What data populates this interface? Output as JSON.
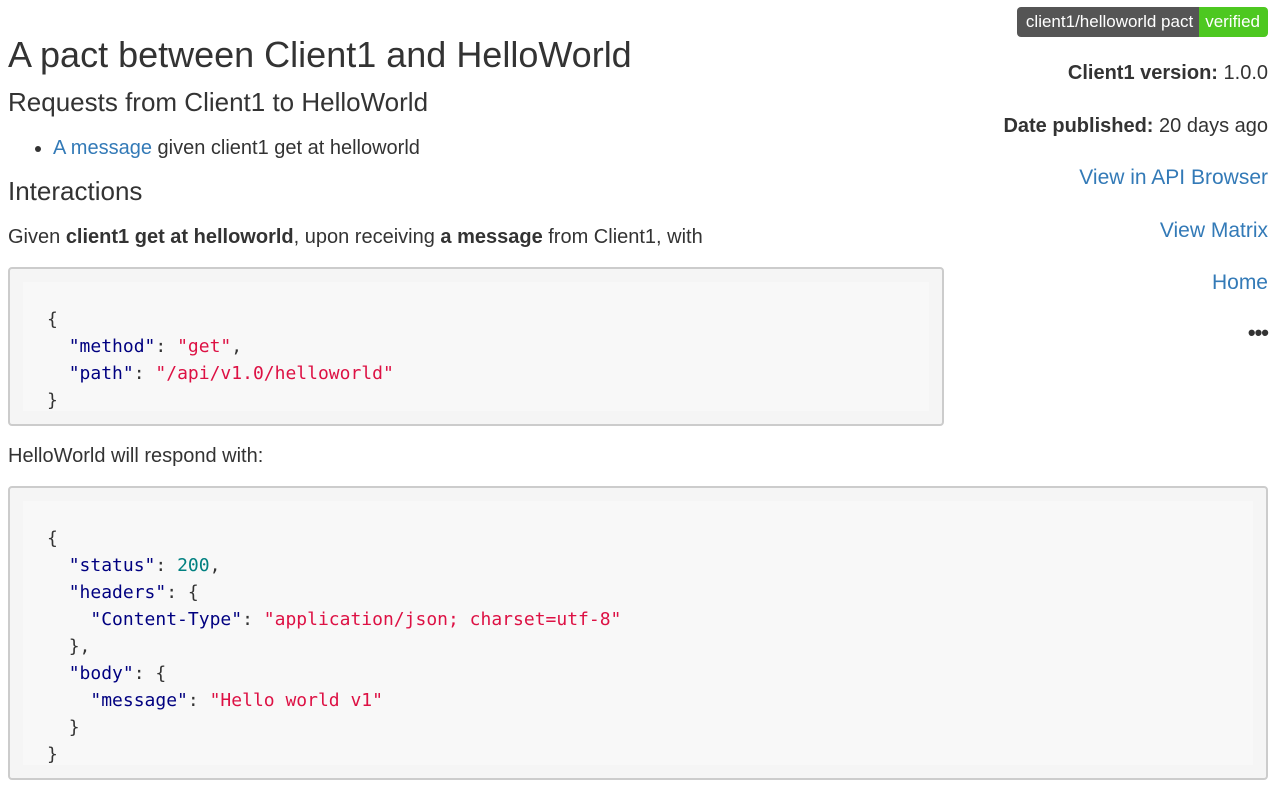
{
  "header": {
    "title": "A pact between Client1 and HelloWorld",
    "subtitle": "Requests from Client1 to HelloWorld"
  },
  "requests": [
    {
      "link_text": "A message",
      "rest": " given client1 get at helloworld"
    }
  ],
  "interactions": {
    "title": "Interactions",
    "given_prefix": "Given ",
    "given_state": "client1 get at helloworld",
    "given_middle": ", upon receiving ",
    "given_message": "a message",
    "given_suffix": " from Client1, with",
    "request_code": {
      "open": "{",
      "method_key": "\"method\"",
      "method_val": "\"get\"",
      "path_key": "\"path\"",
      "path_val": "\"/api/v1.0/helloworld\"",
      "close": "}"
    },
    "respond_text": "HelloWorld will respond with:",
    "response_code": {
      "open": "{",
      "status_key": "\"status\"",
      "status_val": "200",
      "headers_key": "\"headers\"",
      "content_type_key": "\"Content-Type\"",
      "content_type_val": "\"application/json; charset=utf-8\"",
      "headers_close": "},",
      "body_key": "\"body\"",
      "message_key": "\"message\"",
      "message_val": "\"Hello world v1\"",
      "body_close": "}",
      "close": "}"
    }
  },
  "sidebar": {
    "badge_left": "client1/helloworld pact",
    "badge_right": "verified",
    "badge_colors": {
      "left": "#555555",
      "right": "#4dc820"
    },
    "version_label": "Client1 version:",
    "version_value": " 1.0.0",
    "date_label": "Date published:",
    "date_value": " 20 days ago",
    "links": {
      "api_browser": "View in API Browser",
      "matrix": "View Matrix",
      "home": "Home"
    },
    "more": "•••"
  },
  "colors": {
    "link": "#337ab7",
    "json_key": "#000080",
    "json_string": "#dd1144",
    "json_number": "#008080"
  }
}
